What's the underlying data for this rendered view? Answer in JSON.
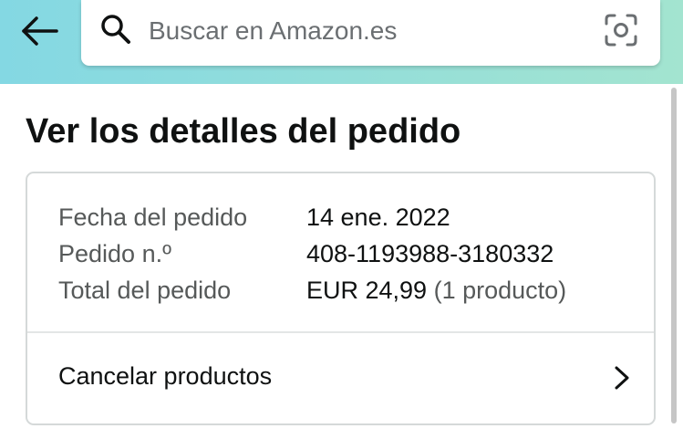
{
  "header": {
    "back_icon": "arrow-left-icon",
    "search": {
      "placeholder": "Buscar en Amazon.es",
      "value": "",
      "search_icon": "magnifier-icon",
      "camera_icon": "camera-scan-icon"
    }
  },
  "page": {
    "title": "Ver los detalles del pedido"
  },
  "order_details": [
    {
      "label": "Fecha del pedido",
      "value": "14 ene. 2022",
      "extra": ""
    },
    {
      "label": "Pedido n.º",
      "value": "408-1193988-3180332",
      "extra": ""
    },
    {
      "label": "Total del pedido",
      "value": "EUR 24,99",
      "extra": "(1 producto)"
    }
  ],
  "actions": {
    "cancel_label": "Cancelar productos",
    "chevron_icon": "chevron-right-icon"
  },
  "colors": {
    "header_gradient_start": "#84d8e3",
    "header_gradient_end": "#a3e4d0",
    "text_primary": "#0f1111",
    "text_secondary": "#565959",
    "card_border": "#d5d9d9"
  }
}
